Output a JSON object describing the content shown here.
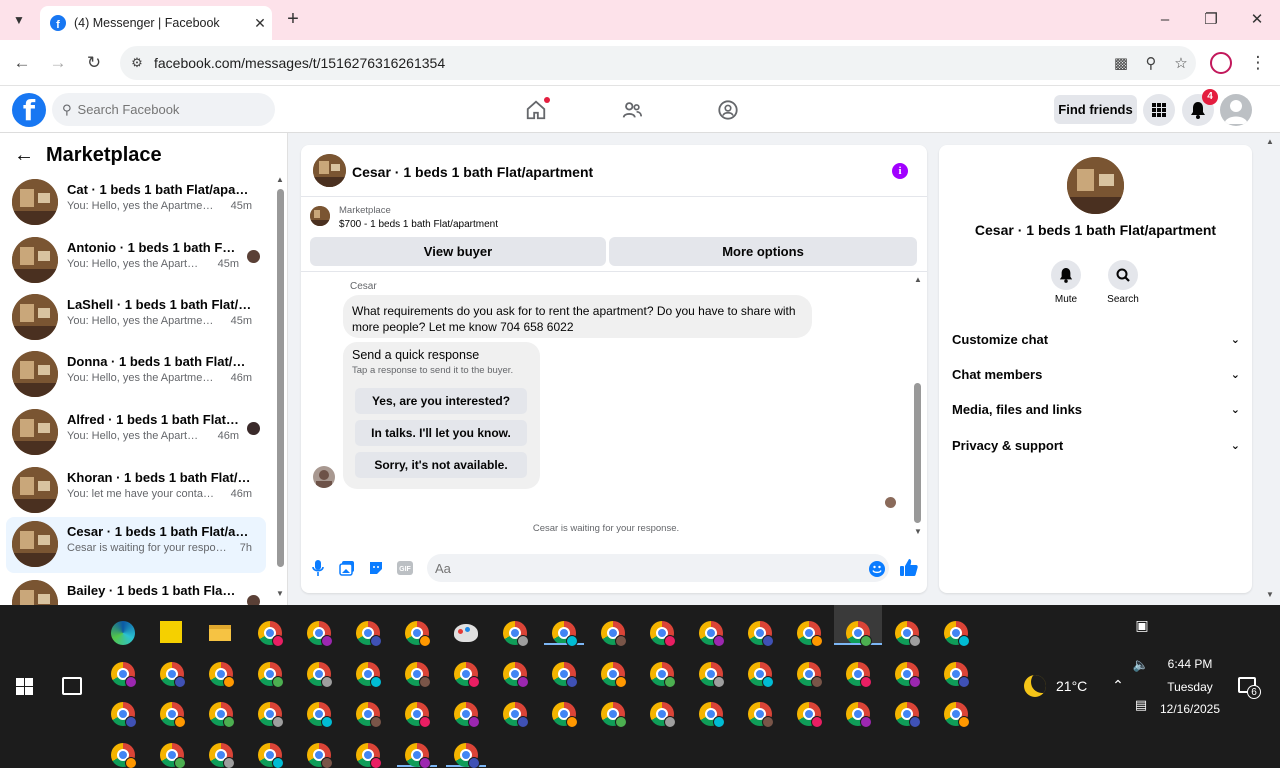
{
  "browser": {
    "tab_title": "(4) Messenger | Facebook",
    "url": "facebook.com/messages/t/1516276316261354"
  },
  "fb_header": {
    "search_placeholder": "Search Facebook",
    "find_friends_label": "Find friends",
    "notification_count": "4"
  },
  "sidebar": {
    "title": "Marketplace",
    "conversations": [
      {
        "name": "Cat · 1 beds 1 bath Flat/apartment",
        "snippet": "You: Hello, yes the Apartment is ...",
        "time": "45m"
      },
      {
        "name": "Antonio · 1 beds 1 bath Flat/a...",
        "snippet": "You: Hello, yes the Apartment ...",
        "time": "45m"
      },
      {
        "name": "LaShell · 1 beds 1 bath Flat/apar...",
        "snippet": "You: Hello, yes the Apartment is ...",
        "time": "45m"
      },
      {
        "name": "Donna · 1 beds 1 bath Flat/apart...",
        "snippet": "You: Hello, yes the Apartment is ...",
        "time": "46m"
      },
      {
        "name": "Alfred · 1 beds 1 bath Flat/apa...",
        "snippet": "You: Hello, yes the Apartment ...",
        "time": "46m"
      },
      {
        "name": "Khoran · 1 beds 1 bath Flat/apar...",
        "snippet": "You: let me have your contact nu...",
        "time": "46m"
      },
      {
        "name": "Cesar · 1 beds 1 bath Flat/apart...",
        "snippet": "Cesar is waiting for your response.",
        "time": "7h"
      },
      {
        "name": "Bailey · 1 beds 1 bath Flat/apa...",
        "snippet": "",
        "time": ""
      }
    ]
  },
  "chat": {
    "title": "Cesar · 1 beds 1 bath Flat/apartment",
    "listing_label": "Marketplace",
    "listing_price": "$700 - 1 beds 1 bath Flat/apartment",
    "view_buyer_label": "View buyer",
    "more_options_label": "More options",
    "sender_name": "Cesar",
    "message_text": "What requirements do you ask for to rent the apartment? Do you have to share with more people? Let me know 704 658 6022",
    "quick_title": "Send a quick response",
    "quick_subtitle": "Tap a response to send it to the buyer.",
    "quick_replies": [
      "Yes, are you interested?",
      "In talks. I'll let you know.",
      "Sorry, it's not available."
    ],
    "waiting_text": "Cesar is waiting for your response.",
    "input_placeholder": "Aa"
  },
  "right_panel": {
    "name": "Cesar · 1 beds 1 bath Flat/apartment",
    "mute_label": "Mute",
    "search_label": "Search",
    "sections": [
      "Customize chat",
      "Chat members",
      "Media, files and links",
      "Privacy & support"
    ]
  },
  "taskbar": {
    "weather": "21°C",
    "time": "6:44 PM",
    "day": "Tuesday",
    "date": "12/16/2025",
    "notification_count": "6"
  },
  "colors": {
    "fb_blue": "#1877f2",
    "messenger_blue": "#0a7cff",
    "info_purple": "#a100ff",
    "badge_red": "#e41e3f",
    "tab_strip_pink": "#fde2ea"
  }
}
